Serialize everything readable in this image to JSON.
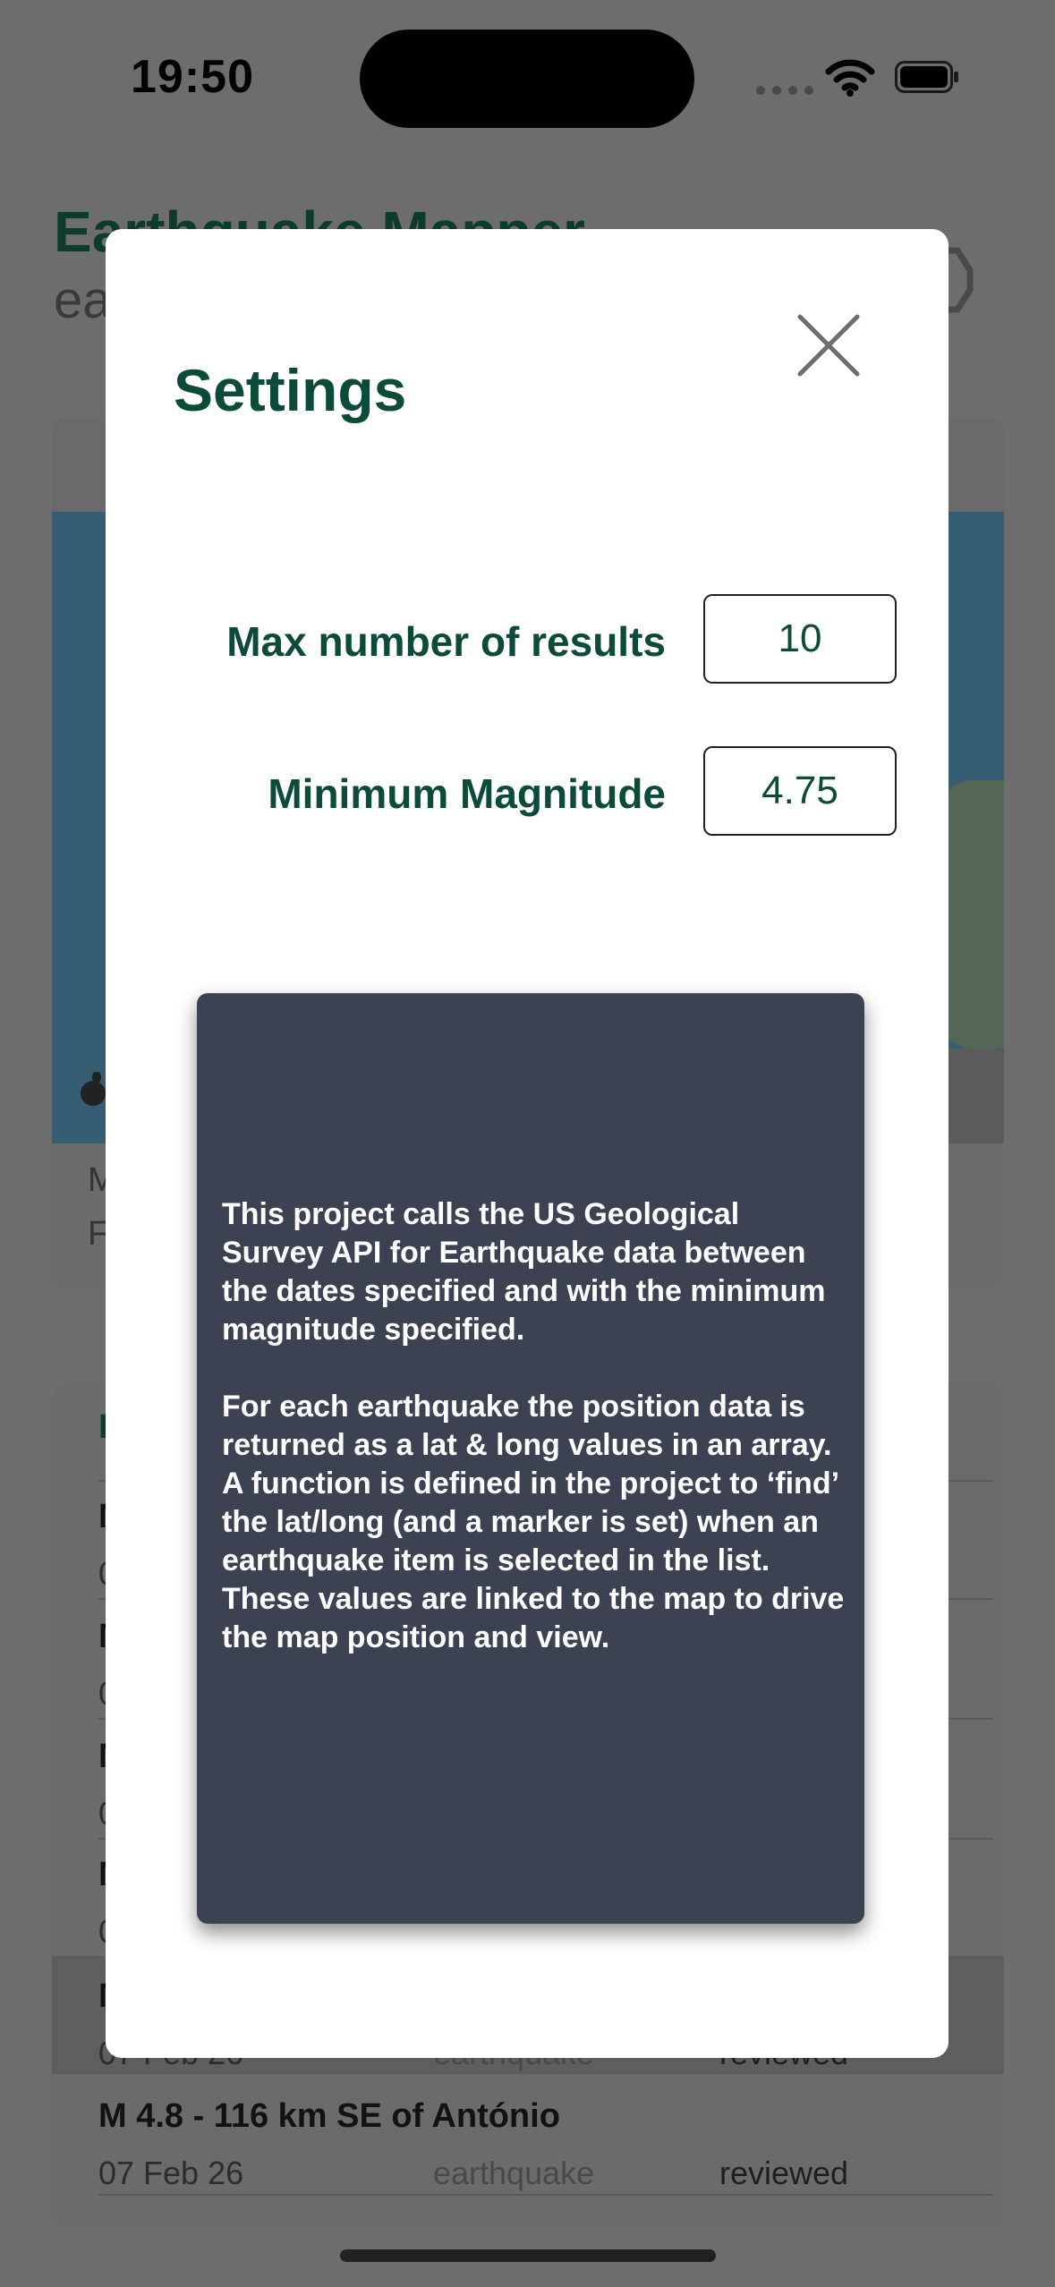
{
  "status_bar": {
    "time": "19:50"
  },
  "background_app": {
    "title": "Earthquake Mapper",
    "subtitle": "ea",
    "map_footer_lines": [
      "M",
      "F"
    ],
    "list_header": "E",
    "list_rows": [
      {
        "title": "M",
        "date": "0",
        "type": "",
        "status": ""
      },
      {
        "title": "M",
        "date": "0",
        "type": "",
        "status": ""
      },
      {
        "title": "M",
        "date": "0",
        "type": "",
        "status": ""
      },
      {
        "title": "M",
        "date": "0",
        "type": "",
        "status": ""
      },
      {
        "title": "M",
        "date": "07 Feb 26",
        "type": "earthquake",
        "status": "reviewed"
      },
      {
        "title": "M 4.8 - 116 km SE of António",
        "date": "07 Feb 26",
        "type": "earthquake",
        "status": "reviewed"
      }
    ]
  },
  "settings": {
    "title": "Settings",
    "max_results_label": "Max number of results",
    "max_results_value": "10",
    "min_magnitude_label": "Minimum Magnitude",
    "min_magnitude_value": "4.75",
    "info_paragraph_1": "This project calls the US Geological Survey API for Earthquake data between the dates specified and with the minimum magnitude specified.",
    "info_paragraph_2": "For each earthquake the position data is returned as a lat & long values in an array. A function is defined in the project to ‘find’ the lat/long (and a marker is set) when an earthquake item is selected in the list. These values are linked to the map to drive the map position and view."
  },
  "colors": {
    "accent": "#0c4a3a",
    "info_box": "#3d4252",
    "overlay": "#6d6d6d"
  }
}
